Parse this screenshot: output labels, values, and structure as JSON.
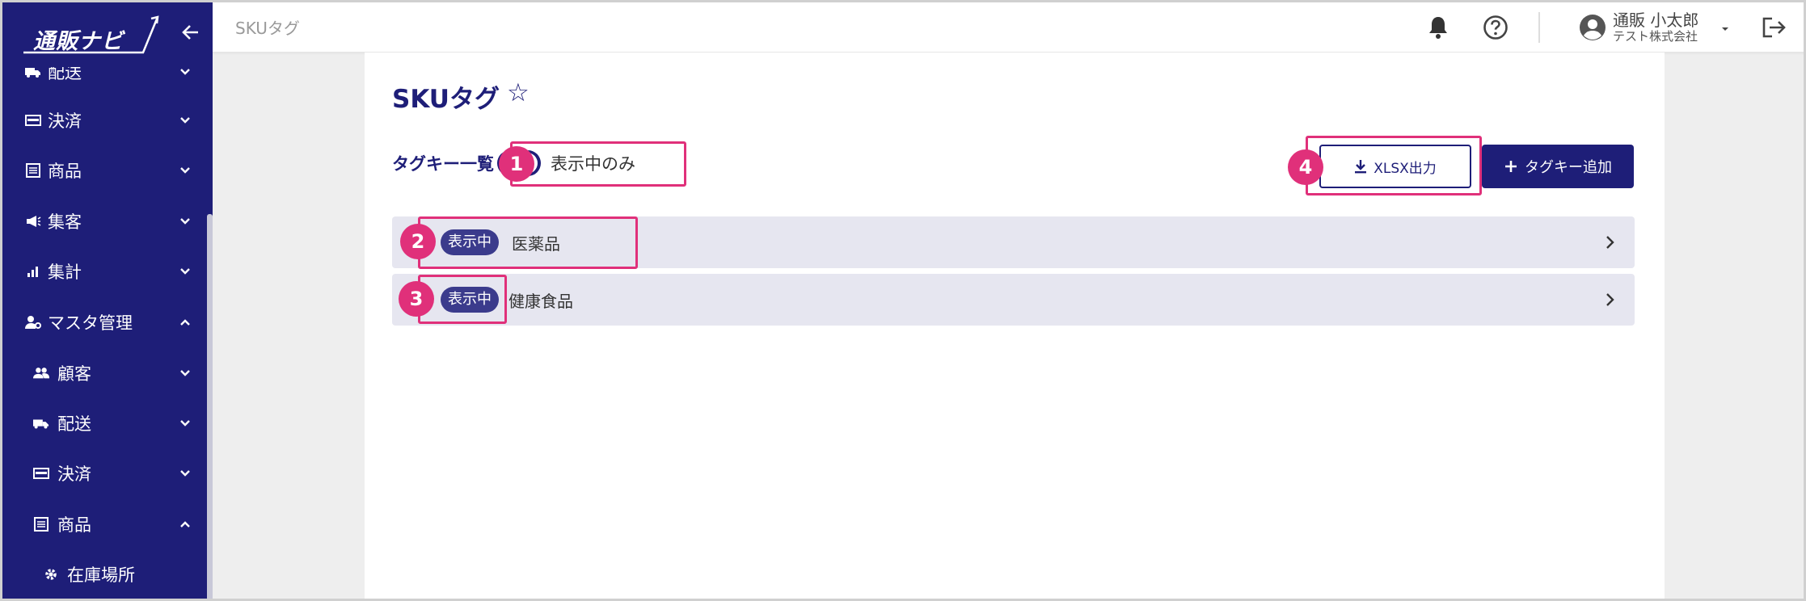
{
  "app": {
    "logo_text": "通販ナビ"
  },
  "sidebar": {
    "items": [
      {
        "label": "配送",
        "icon": "truck-icon",
        "expanded": false
      },
      {
        "label": "決済",
        "icon": "payment-icon",
        "expanded": false
      },
      {
        "label": "商品",
        "icon": "product-list-icon",
        "expanded": false
      },
      {
        "label": "集客",
        "icon": "megaphone-icon",
        "expanded": false
      },
      {
        "label": "集計",
        "icon": "bar-chart-icon",
        "expanded": false
      },
      {
        "label": "マスタ管理",
        "icon": "user-settings-icon",
        "expanded": true
      },
      {
        "label": "顧客",
        "icon": "customers-icon",
        "expanded": false
      },
      {
        "label": "配送",
        "icon": "truck-icon",
        "expanded": false
      },
      {
        "label": "決済",
        "icon": "payment-icon",
        "expanded": false
      },
      {
        "label": "商品",
        "icon": "product-list-icon",
        "expanded": true
      },
      {
        "label": "在庫場所",
        "icon": "gear-icon"
      }
    ]
  },
  "header": {
    "breadcrumb": "SKUタグ",
    "user_name": "通販 小太郎",
    "user_company": "テスト株式会社"
  },
  "page": {
    "title": "SKUタグ",
    "favorite_icon": "☆",
    "section_label": "タグキー一覧",
    "toggle_label": "表示中のみ",
    "toggle_on": true,
    "export_button": "XLSX出力",
    "add_button": "タグキー追加"
  },
  "tags": [
    {
      "badge": "表示中",
      "name": "医薬品"
    },
    {
      "badge": "表示中",
      "name": "健康食品"
    }
  ],
  "callouts": [
    "1",
    "2",
    "3",
    "4"
  ],
  "colors": {
    "primary": "#1e1e78",
    "row_bg": "#e6e6f0",
    "badge": "#3b3b8c",
    "callout": "#e0307a"
  }
}
